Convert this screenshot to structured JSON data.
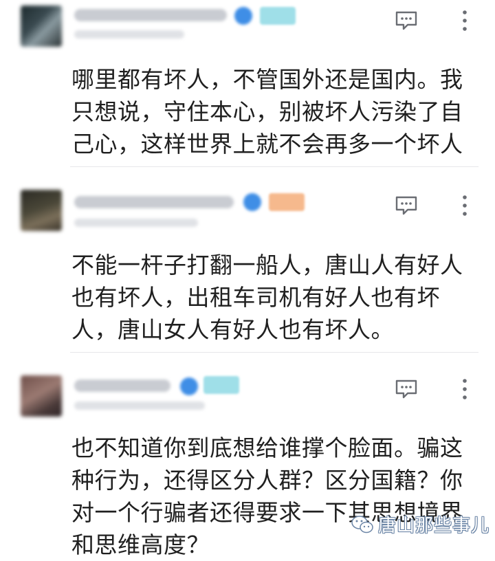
{
  "comments": [
    {
      "text": "哪里都有坏人，不管国外还是国内。我只想说，守住本心，别被坏人污染了自己心，这样世界上就不会再多一个坏人",
      "badge_color": "#9fdfe8"
    },
    {
      "text": "不能一杆子打翻一船人，唐山人有好人也有坏人，出租车司机有好人也有坏人，唐山女人有好人也有坏人。",
      "badge_color": "#f6b98d"
    },
    {
      "text": "也不知道你到底想给谁撑个脸面。骗这种行为，还得区分人群？区分国籍？你对一个行骗者还得要求一下其思想境界和思维高度？",
      "badge_color": "#9fdfe8"
    }
  ],
  "icons": {
    "reply": "comment-reply-icon",
    "more": "more-vertical-icon",
    "verified": "verified-badge-icon"
  },
  "colors": {
    "verified_blue": "#3f8ee6",
    "text": "#202020",
    "icon_gray": "#6a6d73",
    "divider": "#e6e7ea"
  },
  "watermark": {
    "text": "唐山那些事儿"
  }
}
